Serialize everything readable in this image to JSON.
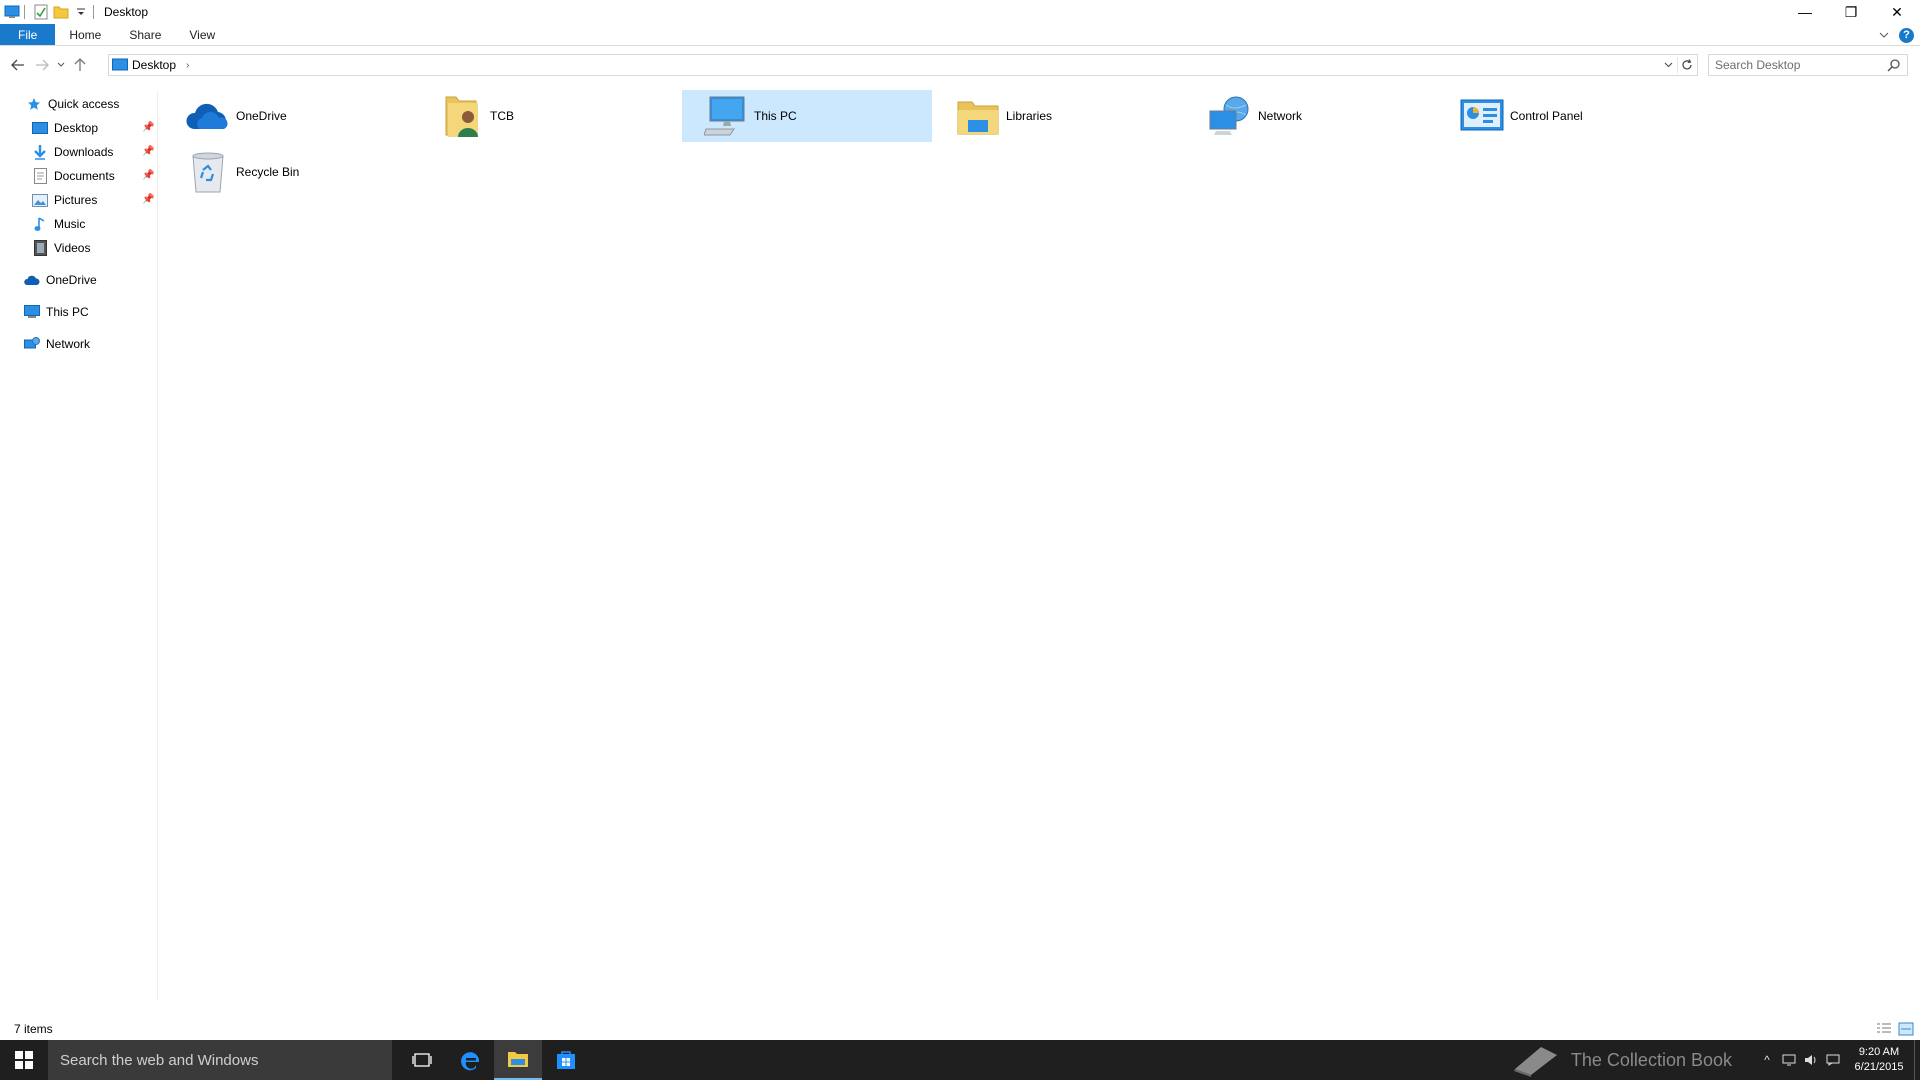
{
  "window": {
    "title": "Desktop",
    "minimize_glyph": "—",
    "restore_glyph": "❐",
    "close_glyph": "✕"
  },
  "ribbon": {
    "tabs": [
      {
        "label": "File"
      },
      {
        "label": "Home"
      },
      {
        "label": "Share"
      },
      {
        "label": "View"
      }
    ],
    "help": "?"
  },
  "address": {
    "crumbs": [
      "Desktop"
    ],
    "search_placeholder": "Search Desktop"
  },
  "navpane": {
    "quick_access": "Quick access",
    "quick_items": [
      {
        "label": "Desktop",
        "pinned": true
      },
      {
        "label": "Downloads",
        "pinned": true
      },
      {
        "label": "Documents",
        "pinned": true
      },
      {
        "label": "Pictures",
        "pinned": true
      },
      {
        "label": "Music",
        "pinned": false
      },
      {
        "label": "Videos",
        "pinned": false
      }
    ],
    "onedrive": "OneDrive",
    "this_pc": "This PC",
    "network": "Network"
  },
  "items": [
    {
      "label": "OneDrive",
      "icon": "onedrive-icon",
      "selected": false
    },
    {
      "label": "TCB",
      "icon": "user-folder-icon",
      "selected": false
    },
    {
      "label": "This PC",
      "icon": "computer-icon",
      "selected": true
    },
    {
      "label": "Libraries",
      "icon": "libraries-icon",
      "selected": false
    },
    {
      "label": "Network",
      "icon": "network-icon",
      "selected": false
    },
    {
      "label": "Control Panel",
      "icon": "control-panel-icon",
      "selected": false
    },
    {
      "label": "Recycle Bin",
      "icon": "recycle-bin-icon",
      "selected": false
    }
  ],
  "status": {
    "count": "7 items"
  },
  "taskbar": {
    "search_placeholder": "Search the web and Windows",
    "watermark": "The Collection Book",
    "time": "9:20 AM",
    "date": "6/21/2015"
  },
  "colors": {
    "accent": "#1979ca",
    "selection": "#cce8ff",
    "taskbar": "#1f1f1f"
  }
}
